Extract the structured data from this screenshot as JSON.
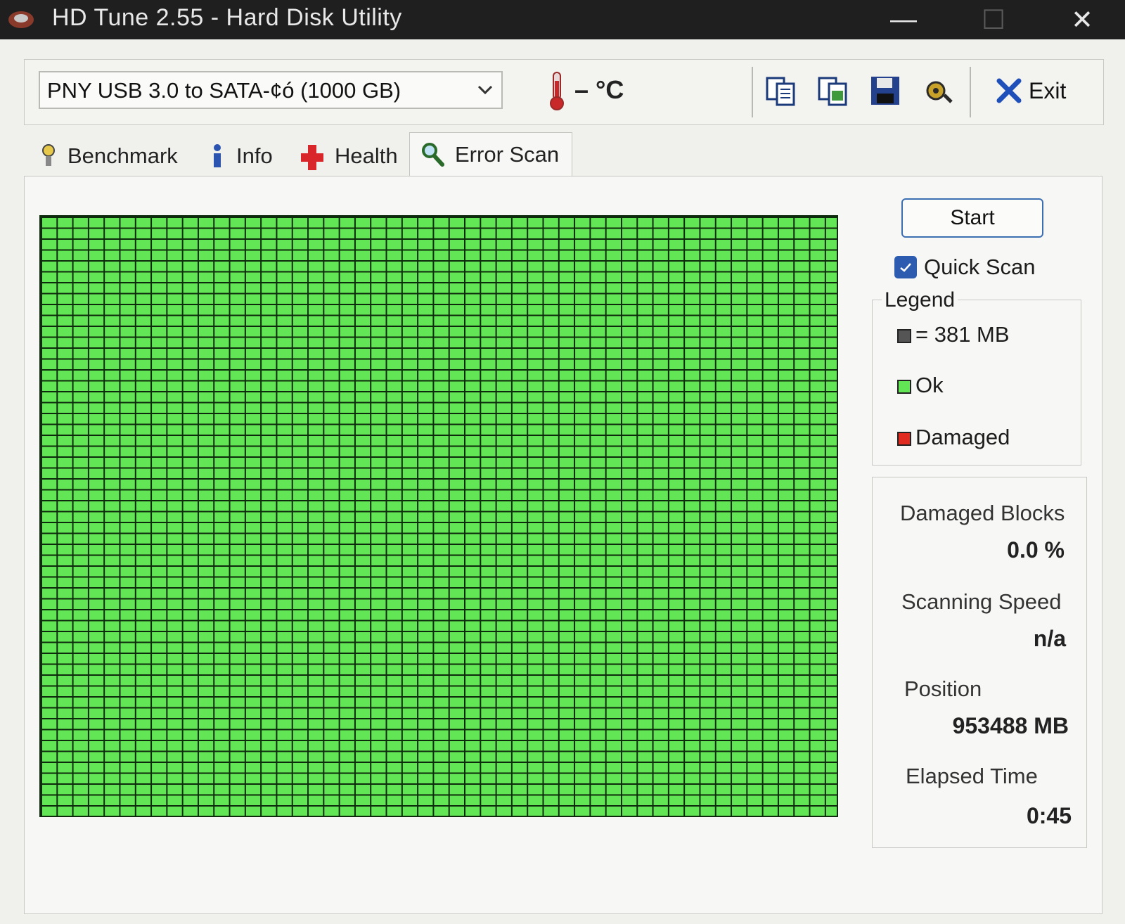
{
  "window": {
    "title": "HD Tune 2.55 - Hard Disk Utility",
    "controls": {
      "minimize": "—",
      "maximize": "☐",
      "close": "✕"
    }
  },
  "toolbar": {
    "drive": "PNY USB 3.0 to SATA-¢ó (1000 GB)",
    "temperature": "– °C",
    "icons": [
      "copy-info-icon",
      "copy-screenshot-icon",
      "save-icon",
      "options-icon"
    ],
    "exit_label": "Exit"
  },
  "tabs": [
    {
      "label": "Benchmark",
      "icon": "benchmark-icon",
      "active": false
    },
    {
      "label": "Info",
      "icon": "info-icon",
      "active": false
    },
    {
      "label": "Health",
      "icon": "health-icon",
      "active": false
    },
    {
      "label": "Error Scan",
      "icon": "magnifier-icon",
      "active": true
    }
  ],
  "error_scan": {
    "start_label": "Start",
    "quick_scan": {
      "label": "Quick Scan",
      "checked": true
    },
    "legend": {
      "title": "Legend",
      "block_size": "= 381 MB",
      "ok": "Ok",
      "damaged": "Damaged"
    },
    "colors": {
      "ok": "#62e655",
      "damaged": "#e02b20",
      "block": "#555555",
      "accent": "#2c5bb0"
    },
    "stats": {
      "damaged_blocks_label": "Damaged Blocks",
      "damaged_blocks_value": "0.0 %",
      "scanning_speed_label": "Scanning Speed",
      "scanning_speed_value": "n/a",
      "position_label": "Position",
      "position_value": "953488 MB",
      "elapsed_label": "Elapsed Time",
      "elapsed_value": "0:45"
    }
  }
}
